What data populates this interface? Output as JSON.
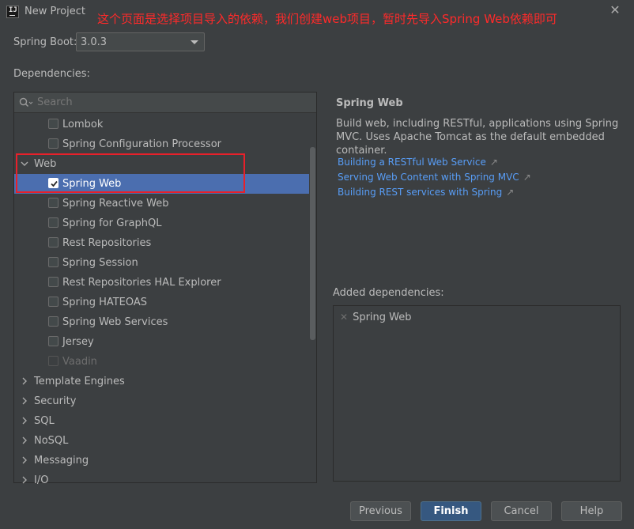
{
  "window": {
    "title": "New Project",
    "annotation": "这个页面是选择项目导入的依赖，我们创建web项目，暂时先导入Spring Web依赖即可"
  },
  "boot": {
    "label": "Spring Boot:",
    "value": "3.0.3"
  },
  "dependencies_label": "Dependencies:",
  "search": {
    "placeholder": "Search",
    "value": ""
  },
  "tree": {
    "lombok": "Lombok",
    "config_processor": "Spring Configuration Processor",
    "web_group": "Web",
    "web_items": [
      {
        "label": "Spring Web",
        "checked": true
      },
      {
        "label": "Spring Reactive Web",
        "checked": false
      },
      {
        "label": "Spring for GraphQL",
        "checked": false
      },
      {
        "label": "Rest Repositories",
        "checked": false
      },
      {
        "label": "Spring Session",
        "checked": false
      },
      {
        "label": "Rest Repositories HAL Explorer",
        "checked": false
      },
      {
        "label": "Spring HATEOAS",
        "checked": false
      },
      {
        "label": "Spring Web Services",
        "checked": false
      },
      {
        "label": "Jersey",
        "checked": false
      },
      {
        "label": "Vaadin",
        "checked": false,
        "disabled": true
      }
    ],
    "groups": [
      "Template Engines",
      "Security",
      "SQL",
      "NoSQL",
      "Messaging",
      "I/O"
    ]
  },
  "detail": {
    "title": "Spring Web",
    "description": "Build web, including RESTful, applications using Spring MVC. Uses Apache Tomcat as the default embedded container.",
    "links": [
      "Building a RESTful Web Service",
      "Serving Web Content with Spring MVC",
      "Building REST services with Spring"
    ]
  },
  "added": {
    "label": "Added dependencies:",
    "items": [
      "Spring Web"
    ]
  },
  "buttons": {
    "previous": "Previous",
    "finish": "Finish",
    "cancel": "Cancel",
    "help": "Help"
  },
  "colors": {
    "background": "#3c3f41",
    "selection": "#4b6eaf",
    "link": "#589df6",
    "annotation": "#ff2a2a",
    "highlight_border": "#e8202a",
    "finish_button": "#365880"
  },
  "icons": [
    "app-logo-icon",
    "close-icon",
    "chevron-down-icon",
    "search-icon",
    "chevron-right-icon",
    "checkbox-icon",
    "external-link-icon",
    "remove-icon"
  ]
}
